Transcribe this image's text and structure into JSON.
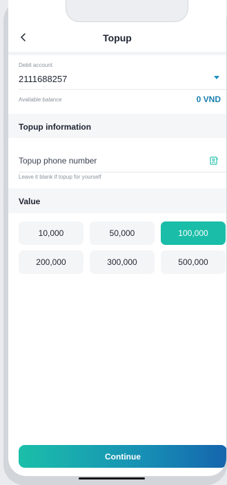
{
  "header": {
    "title": "Topup"
  },
  "debit": {
    "label": "Debit account",
    "account_number": "2111688257",
    "balance_label": "Available balance",
    "balance_value": "0 VND"
  },
  "topup_info": {
    "section_title": "Topup information",
    "phone_placeholder": "Topup phone number",
    "hint": "Leave it blank if topup for yourself"
  },
  "values": {
    "section_title": "Value",
    "options": [
      "10,000",
      "50,000",
      "100,000",
      "200,000",
      "300,000",
      "500,000"
    ],
    "selected": "100,000"
  },
  "footer": {
    "continue_label": "Continue"
  },
  "colors": {
    "accent": "#1abda8",
    "balance": "#1a7fb0",
    "gradient_end": "#1565ad"
  }
}
